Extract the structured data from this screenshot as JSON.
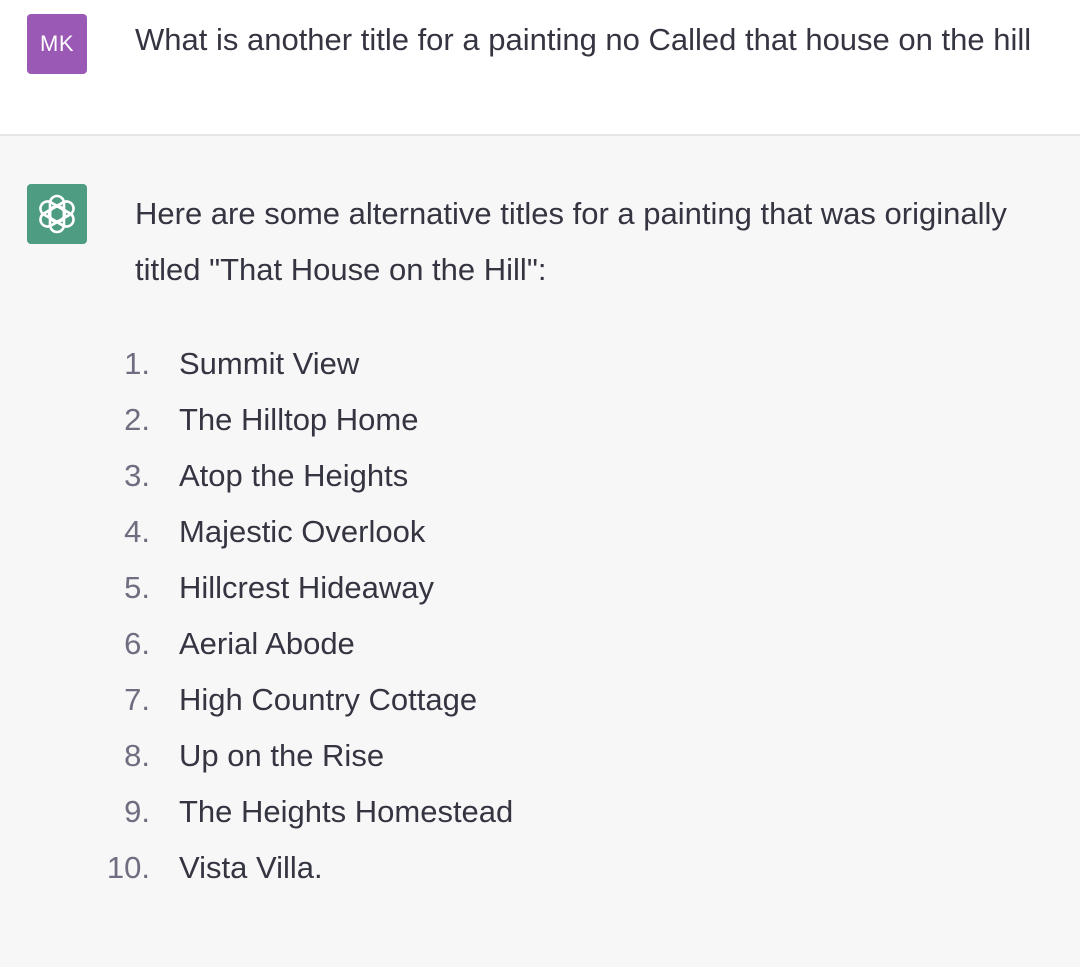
{
  "user": {
    "avatar_initials": "MK",
    "avatar_color": "#9b59b6",
    "message": "What is another title for a painting no Called that house on the hill"
  },
  "assistant": {
    "avatar_icon": "openai-logo-icon",
    "avatar_color": "#4e9c81",
    "intro": "Here are some alternative titles for a painting that was originally titled \"That House on the Hill\":",
    "list": [
      {
        "num": "1.",
        "text": "Summit View"
      },
      {
        "num": "2.",
        "text": "The Hilltop Home"
      },
      {
        "num": "3.",
        "text": "Atop the Heights"
      },
      {
        "num": "4.",
        "text": "Majestic Overlook"
      },
      {
        "num": "5.",
        "text": "Hillcrest Hideaway"
      },
      {
        "num": "6.",
        "text": "Aerial Abode"
      },
      {
        "num": "7.",
        "text": "High Country Cottage"
      },
      {
        "num": "8.",
        "text": "Up on the Rise"
      },
      {
        "num": "9.",
        "text": "The Heights Homestead"
      },
      {
        "num": "10.",
        "text": "Vista Villa."
      }
    ]
  }
}
